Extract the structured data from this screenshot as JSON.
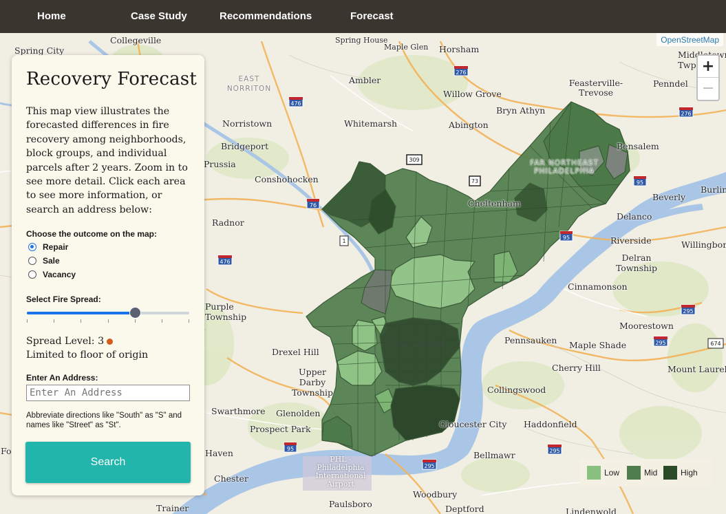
{
  "nav": [
    {
      "label": "Home"
    },
    {
      "label": "Case Study"
    },
    {
      "label": "Recommendations"
    },
    {
      "label": "Forecast"
    }
  ],
  "map": {
    "attribution": "OpenStreetMap",
    "zoom_in": "+",
    "zoom_out": "−",
    "places": [
      "Spring City",
      "Collegeville",
      "Spring House",
      "Maple Glen",
      "Horsham",
      "Middletown Twp",
      "EAST NORRITON",
      "Ambler",
      "Feasterville-Trevose",
      "Penndel",
      "Willow Grove",
      "Bryn Athyn",
      "Norristown",
      "Whitemarsh",
      "Abington",
      "Bensalem",
      "Bridgeport",
      "Prussia",
      "FAR NORTHEAST PHILADELPHIA",
      "Conshohocken",
      "Cheltenham",
      "Burling",
      "Beverly",
      "Radnor",
      "Delanco",
      "Riverside",
      "Willingboro",
      "Delran Township",
      "Cinnamonson",
      "Purple Township",
      "Moorestown",
      "Philadelphia",
      "Pennsauken",
      "Maple Shade",
      "Drexel Hill",
      "Cherry Hill",
      "Mount Laurel",
      "Upper Darby Township",
      "Collingswood",
      "Swarthmore",
      "Glenolden",
      "Gloucester City",
      "Haddonfield",
      "Prospect Park",
      "Haven",
      "Bellmawr",
      "Chester",
      "PHL - Philadelphia International Airport",
      "Woodbury",
      "Paulsboro",
      "Deptford",
      "Trainer",
      "Lindenwold",
      "Fo"
    ],
    "shields": [
      "276",
      "476",
      "309",
      "73",
      "95",
      "76",
      "1",
      "276",
      "95",
      "295",
      "674",
      "295",
      "95",
      "295",
      "295",
      "476"
    ]
  },
  "panel": {
    "title": "Recovery Forecast",
    "description": "This map view illustrates the forecasted differences in fire recovery among neighborhoods, block groups, and individual parcels after 2 years. Zoom in to see more detail. Click each area to see more information, or search an address below:",
    "outcome_label": "Choose the outcome on the map:",
    "outcomes": [
      {
        "label": "Repair",
        "selected": true
      },
      {
        "label": "Sale",
        "selected": false
      },
      {
        "label": "Vacancy",
        "selected": false
      }
    ],
    "spread_label": "Select Fire Spread:",
    "spread_level": 3,
    "spread_max": 6,
    "spread_text": "Spread Level: 3",
    "spread_color": "#d45b1e",
    "spread_desc": "Limited to floor of origin",
    "address_label": "Enter An Address:",
    "address_placeholder": "Enter An Address",
    "address_value": "",
    "hint": "Abbreviate directions like \"South\" as \"S\" and names like \"Street\" as \"St\".",
    "search_label": "Search",
    "search_color": "#22b5ab"
  },
  "legend": [
    {
      "label": "Low",
      "color": "#88c17f"
    },
    {
      "label": "Mid",
      "color": "#4e7e4b"
    },
    {
      "label": "High",
      "color": "#2b4a28"
    }
  ]
}
